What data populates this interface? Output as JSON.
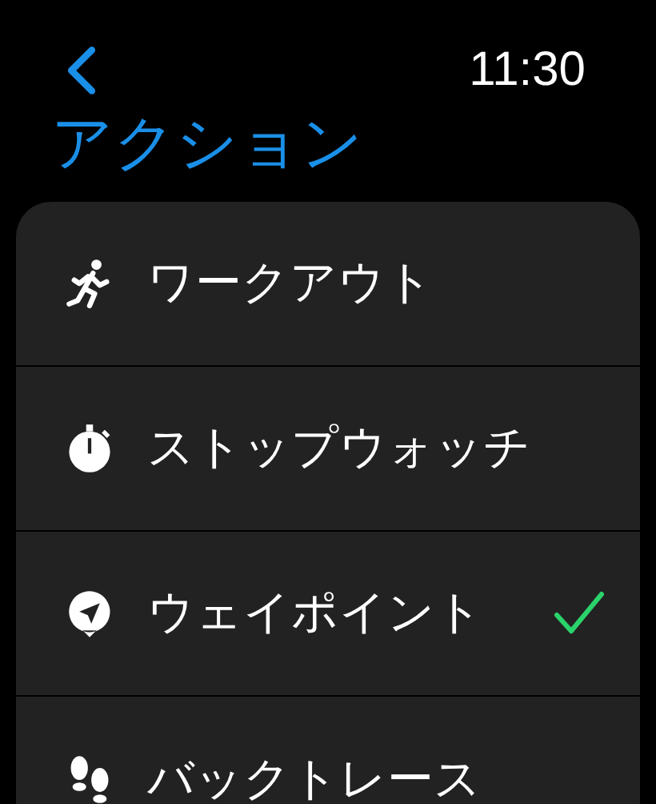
{
  "status_bar": {
    "time": "11:30"
  },
  "title": "アクション",
  "items": [
    {
      "label": "ワークアウト",
      "checked": false
    },
    {
      "label": "ストップウォッチ",
      "checked": false
    },
    {
      "label": "ウェイポイント",
      "checked": true
    },
    {
      "label": "バックトレース",
      "checked": false
    }
  ]
}
